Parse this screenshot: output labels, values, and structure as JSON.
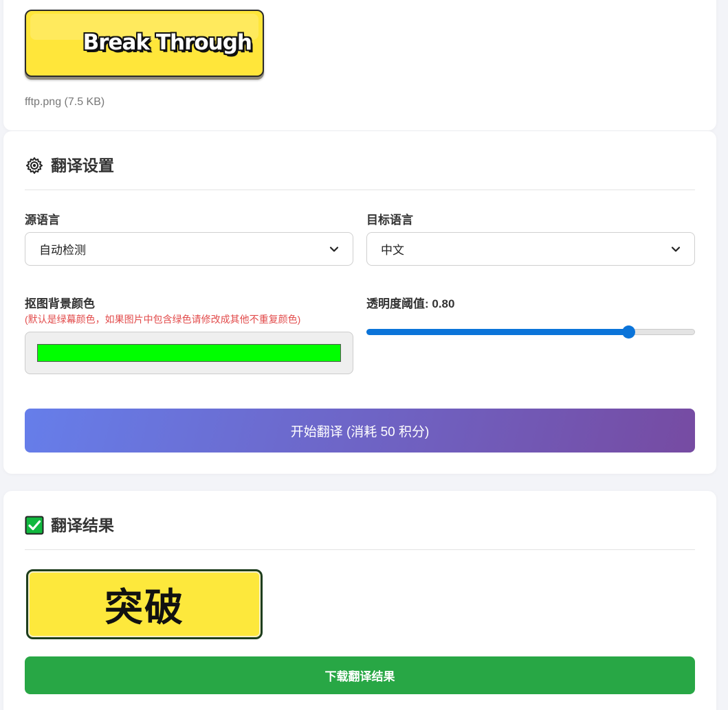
{
  "upload": {
    "preview_text": "Break Through",
    "file_info": "fftp.png (7.5 KB)"
  },
  "settings": {
    "title": "翻译设置",
    "source_language": {
      "label": "源语言",
      "value": "自动检测"
    },
    "target_language": {
      "label": "目标语言",
      "value": "中文"
    },
    "matting_color": {
      "label": "抠图背景颜色",
      "hint": "(默认是绿幕颜色，如果图片中包含绿色请修改成其他不重复颜色)",
      "value": "#00ff00"
    },
    "threshold": {
      "label": "透明度阈值: 0.80",
      "value": 0.8
    },
    "start_button": "开始翻译 (消耗 50 积分)"
  },
  "result": {
    "title": "翻译结果",
    "image_text": "突破",
    "download_button": "下载翻译结果"
  },
  "colors": {
    "background": "#f3f4f8",
    "primary_gradient_start": "#667eea",
    "primary_gradient_end": "#764ba2",
    "success": "#28a745",
    "slider": "#0b74d9",
    "hint": "#e24b4b"
  }
}
